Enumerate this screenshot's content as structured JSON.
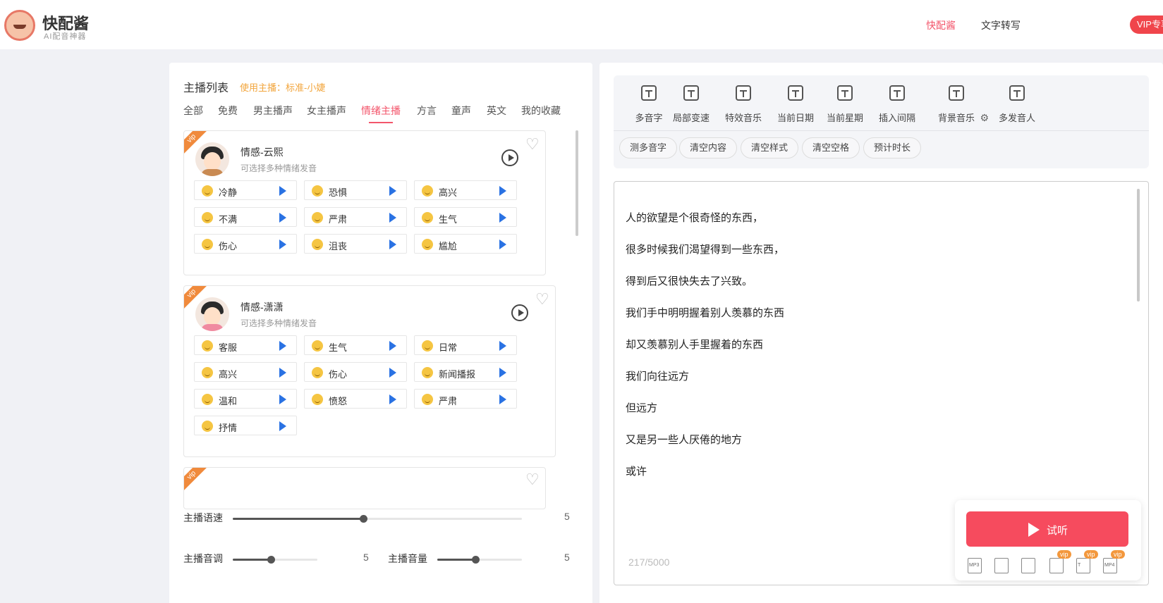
{
  "header": {
    "brand": "快配酱",
    "brand_sub": "AI配音神器",
    "nav": [
      "快配酱",
      "文字转写"
    ],
    "vip": "VIP专享"
  },
  "left": {
    "title": "主播列表",
    "current": "使用主播：标准-小婕",
    "tabs": [
      "全部",
      "免费",
      "男主播声",
      "女主播声",
      "情绪主播",
      "方言",
      "童声",
      "英文",
      "我的收藏"
    ],
    "anchors": [
      {
        "badge": "vip",
        "name": "情感-云熙",
        "desc": "可选择多种情绪发音",
        "emotions": [
          "冷静",
          "恐惧",
          "高兴",
          "不满",
          "严肃",
          "生气",
          "伤心",
          "沮丧",
          "尴尬"
        ]
      },
      {
        "badge": "vip",
        "name": "情感-潇潇",
        "desc": "可选择多种情绪发音",
        "emotions": [
          "客服",
          "生气",
          "日常",
          "高兴",
          "伤心",
          "新闻播报",
          "温和",
          "愤怒",
          "严肃",
          "抒情"
        ]
      },
      {
        "badge": "vip"
      }
    ],
    "sliders": {
      "speed": {
        "label": "主播语速",
        "value": "5",
        "fraction": 0.45
      },
      "pitch": {
        "label": "主播音调",
        "value": "5",
        "fraction": 0.45
      },
      "volume": {
        "label": "主播音量",
        "value": "5",
        "fraction": 0.45
      }
    }
  },
  "right": {
    "tools": [
      "多音字",
      "局部变速",
      "特效音乐",
      "当前日期",
      "当前星期",
      "插入间隔",
      "背景音乐",
      "多发音人"
    ],
    "actions": [
      "测多音字",
      "清空内容",
      "清空样式",
      "清空空格",
      "预计时长"
    ],
    "lines": [
      "人的欲望是个很奇怪的东西，",
      "很多时候我们渴望得到一些东西，",
      "得到后又很快失去了兴致。",
      "我们手中明明握着别人羡慕的东西",
      "却又羡慕别人手里握着的东西",
      "我们向往远方",
      "但远方",
      "又是另一些人厌倦的地方",
      "或许"
    ],
    "counter": "217/5000",
    "try_label": "试听",
    "dock": [
      {
        "name": "mp3-icon",
        "text": "MP3",
        "vip": ""
      },
      {
        "name": "phone-icon",
        "text": "",
        "vip": ""
      },
      {
        "name": "save-icon",
        "text": "",
        "vip": ""
      },
      {
        "name": "list-icon",
        "text": "",
        "vip": "vip"
      },
      {
        "name": "text-file-icon",
        "text": "T",
        "vip": "vip"
      },
      {
        "name": "mp4-icon",
        "text": "MP4",
        "vip": "vip"
      }
    ]
  }
}
